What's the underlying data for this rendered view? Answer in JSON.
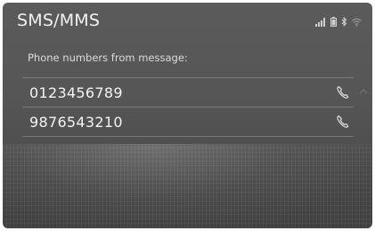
{
  "header": {
    "title": "SMS/MMS"
  },
  "status_bar": {
    "icons": [
      "signal-icon",
      "battery-icon",
      "bluetooth-icon",
      "wifi-icon"
    ]
  },
  "main": {
    "subtitle": "Phone numbers from message:",
    "numbers": [
      {
        "number": "0123456789",
        "icon": "phone-icon"
      },
      {
        "number": "9876543210",
        "icon": "phone-icon"
      }
    ]
  }
}
